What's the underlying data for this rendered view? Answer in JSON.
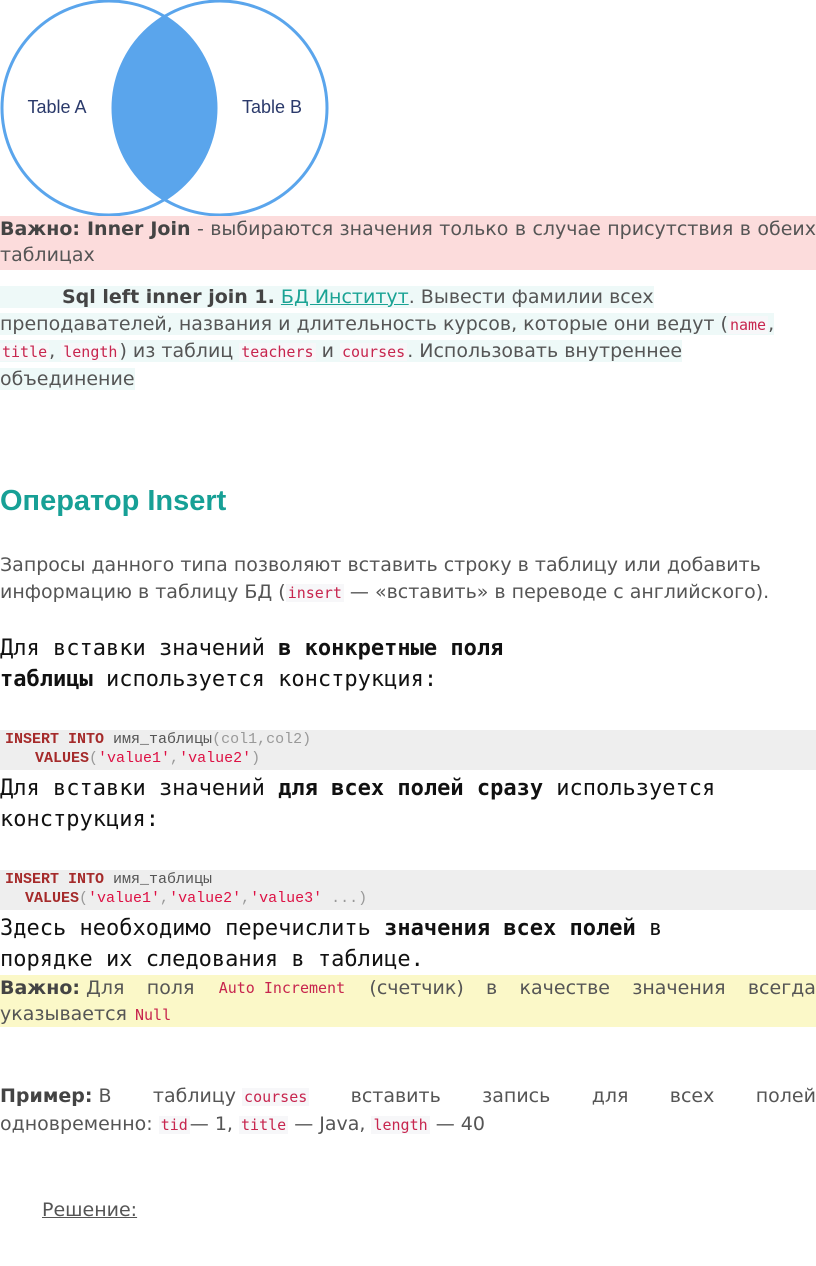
{
  "venn": {
    "left_label": "Table A",
    "right_label": "Table B",
    "fill_color": "#5aa5ec",
    "stroke_color": "#5aa5ec"
  },
  "note_inner": {
    "bold": "Важно: Inner Join",
    "text": " - выбираются значения только в случае присутствия в обеих таблицах"
  },
  "task": {
    "title": "Sql left inner join 1.",
    "link": "БД Институт",
    "t1": ". Вывести фамилии всех преподавателей, названия и длительность курсов, которые они ведут (",
    "c1": "name",
    "sep1": ", ",
    "c2": "title",
    "sep2": ", ",
    "c3": "length",
    "t2": ") из таблиц ",
    "c4": "teachers",
    "t3": " и ",
    "c5": "courses",
    "t4": ". Использовать внутреннее объединение"
  },
  "heading": "Оператор Insert",
  "para1": {
    "t1": "Запросы данного типа позволяют вставить строку в таблицу или добавить информацию в таблицу БД (",
    "code": "insert",
    "t2": " — «вставить» в переводе с английского)."
  },
  "para2": {
    "t1": "Для вставки значений ",
    "bold": "в конкретные поля таблицы",
    "t2": " используется конструкция:"
  },
  "code1": {
    "kw1": "INSERT INTO",
    "name": " имя_таблицы",
    "args": "(col1,col2)",
    "kw2": "VALUES",
    "open": "(",
    "v1": "'value1'",
    "comma": ",",
    "v2": "'value2'",
    "close": ")"
  },
  "para3": {
    "t1": "Для вставки значений ",
    "bold": "для всех полей сразу",
    "t2": " используется конструкция:"
  },
  "code2": {
    "kw1": "INSERT INTO",
    "name": " имя_таблицы",
    "kw2": "VALUES",
    "open": "(",
    "v1": "'value1'",
    "comma1": ",",
    "v2": "'value2'",
    "comma2": ",",
    "v3": "'value3'",
    "rest": " ...)"
  },
  "para4": {
    "t1": "Здесь необходимо перечислить ",
    "bold": "значения всех полей",
    "t2": " в порядке их следования в таблице."
  },
  "note_auto": {
    "bold": "Важно:",
    "w1": "Для",
    "w2": "поля",
    "code": "Auto Increment",
    "w3": "(счетчик)",
    "w4": "в",
    "w5": "качестве",
    "w6": "значения",
    "w7": "всегда",
    "line2": "указывается",
    "code2": "Null"
  },
  "example": {
    "bold": "Пример:",
    "w1": "В",
    "w2": "таблицу",
    "code1": "courses",
    "w3": "вставить",
    "w4": "запись",
    "w5": "для",
    "w6": "всех",
    "w7": "полей",
    "l2a": "одновременно: ",
    "c2": "tid",
    "l2b": "— 1, ",
    "c3": "title",
    "l2c": " — Java, ",
    "c4": "length",
    "l2d": " — 40"
  },
  "solution": "Решение:"
}
